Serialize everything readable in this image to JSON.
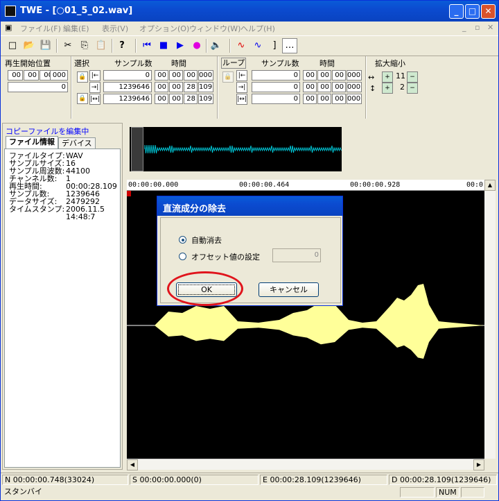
{
  "window": {
    "title": "TWE - [○01_5_02.wav]",
    "title_icon": "app-icon"
  },
  "menu": [
    "ファイル(F)",
    "編集(E)",
    "表示(V)",
    "オプション(O)",
    "ウィンドウ(W)",
    "ヘルプ(H)"
  ],
  "toolbar": {
    "buttons": [
      "new-file-icon",
      "open-folder-icon",
      "save-icon",
      "cut-icon",
      "copy-icon",
      "paste-icon",
      "help-icon",
      "rewind-icon",
      "stop-icon",
      "play-icon",
      "record-icon",
      "speaker-icon",
      "wave-red-icon",
      "wave-blue-icon",
      "marker-icon",
      "ruler-icon"
    ],
    "glyphs": [
      "□",
      "📂",
      "💾",
      "✂",
      "⎘",
      "📋",
      "?",
      "⏮",
      "■",
      "▶",
      "●",
      "🔈",
      "∿",
      "∿",
      "]",
      "…"
    ]
  },
  "playstart": {
    "label": "再生開始位置",
    "time": [
      "00",
      "00",
      "00",
      "000"
    ],
    "sample": "0"
  },
  "selection": {
    "label": "選択",
    "samples_header": "サンプル数",
    "time_header": "時間",
    "rows": [
      {
        "samples": "0",
        "time": [
          "00",
          "00",
          "00",
          "000"
        ]
      },
      {
        "samples": "1239646",
        "time": [
          "00",
          "00",
          "28",
          "109"
        ]
      },
      {
        "samples": "1239646",
        "time": [
          "00",
          "00",
          "28",
          "109"
        ]
      }
    ]
  },
  "loop": {
    "label": "ループ",
    "samples_header": "サンプル数",
    "time_header": "時間",
    "rows": [
      {
        "samples": "0",
        "time": [
          "00",
          "00",
          "00",
          "000"
        ]
      },
      {
        "samples": "0",
        "time": [
          "00",
          "00",
          "00",
          "000"
        ]
      },
      {
        "samples": "0",
        "time": [
          "00",
          "00",
          "00",
          "000"
        ]
      }
    ]
  },
  "zoom": {
    "label": "拡大縮小",
    "h_level": "11",
    "v_level": "2"
  },
  "leftpane": {
    "header": "コピーファイルを編集中",
    "tabs": [
      "ファイル情報",
      "デバイス"
    ],
    "info": [
      {
        "k": "ファイルタイプ:",
        "v": "WAV"
      },
      {
        "k": "サンプルサイズ:",
        "v": "16"
      },
      {
        "k": "サンプル周波数:",
        "v": "44100"
      },
      {
        "k": "チャンネル数:",
        "v": "1"
      },
      {
        "k": "再生時間:",
        "v": "00:00:28.109"
      },
      {
        "k": "サンプル数:",
        "v": "1239646"
      },
      {
        "k": "データサイズ:",
        "v": "2479292"
      },
      {
        "k": "タイムスタンプ:",
        "v": "2006.11.5"
      },
      {
        "k": "",
        "v": "14:48:7"
      }
    ]
  },
  "ruler": [
    "00:00:00.000",
    "00:00:00.464",
    "00:00:00.928",
    "00:0"
  ],
  "status": {
    "n": "N 00:00:00.748(33024)",
    "s": "S 00:00:00.000(0)",
    "e": "E 00:00:28.109(1239646)",
    "d": "D 00:00:28.109(1239646)",
    "state": "スタンバイ",
    "num": "NUM"
  },
  "dialog": {
    "title": "直流成分の除去",
    "auto_label": "自動消去",
    "offset_label": "オフセット値の設定",
    "offset_value": "0",
    "ok": "OK",
    "cancel": "キャンセル"
  },
  "colors": {
    "wave": "#ffff99",
    "overview_wave": "#00c8d8",
    "highlight_ring": "#e0141c"
  }
}
